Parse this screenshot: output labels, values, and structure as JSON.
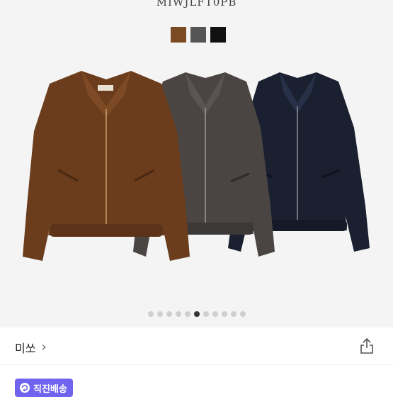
{
  "product": {
    "model_code": "MIWJLFT0PB",
    "swatches": [
      {
        "name": "brown",
        "color": "#7a4a22"
      },
      {
        "name": "gray",
        "color": "#555555"
      },
      {
        "name": "black",
        "color": "#111111"
      }
    ],
    "jacket_colors": {
      "brown": "#6b3d1d",
      "gray": "#4a4543",
      "navy": "#1a2030"
    },
    "carousel": {
      "total": 11,
      "active_index": 6
    }
  },
  "store": {
    "name": "미쏘",
    "chevron": "›"
  },
  "badge": {
    "label": "직진배송",
    "color": "#6f63ef"
  }
}
